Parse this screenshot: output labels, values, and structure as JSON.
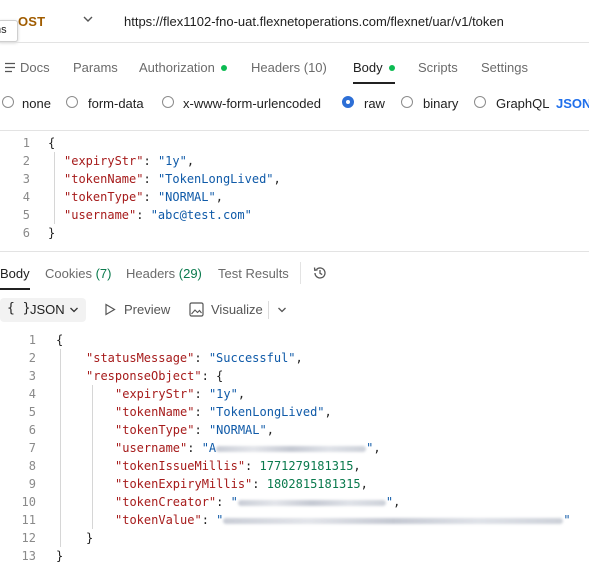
{
  "request": {
    "method": "OST",
    "url": "https://flex1102-fno-uat.flexnetoperations.com/flexnet/uar/v1/token",
    "tooltip": "ns"
  },
  "request_tabs": [
    {
      "label": "Docs"
    },
    {
      "label": "Params"
    },
    {
      "label": "Authorization"
    },
    {
      "label": "Headers (10)"
    },
    {
      "label": "Body"
    },
    {
      "label": "Scripts"
    },
    {
      "label": "Settings"
    }
  ],
  "body_types": [
    "none",
    "form-data",
    "x-www-form-urlencoded",
    "raw",
    "binary",
    "GraphQL"
  ],
  "body_format": "JSON",
  "request_body": {
    "line_numbers": [
      "1",
      "2",
      "3",
      "4",
      "5",
      "6"
    ],
    "open": "{",
    "close": "}",
    "lines": [
      {
        "key": "\"expiryStr\"",
        "value": "\"1y\""
      },
      {
        "key": "\"tokenName\"",
        "value": "\"TokenLongLived\""
      },
      {
        "key": "\"tokenType\"",
        "value": "\"NORMAL\""
      },
      {
        "key": "\"username\"",
        "value": "\"abc@test.com\""
      }
    ]
  },
  "response_tabs": [
    {
      "label": "Body"
    },
    {
      "label": "Cookies",
      "count": "(7)"
    },
    {
      "label": "Headers",
      "count": "(29)"
    },
    {
      "label": "Test Results"
    }
  ],
  "response_toolbar": {
    "format": "JSON",
    "preview": "Preview",
    "visualize": "Visualize"
  },
  "response_body": {
    "line_numbers": [
      "1",
      "2",
      "3",
      "4",
      "5",
      "6",
      "7",
      "8",
      "9",
      "10",
      "11",
      "12",
      "13"
    ],
    "brace_open": "{",
    "brace_close": "}",
    "status_key": "\"statusMessage\"",
    "status_value": "\"Successful\"",
    "response_object_key": "\"responseObject\"",
    "inner_open": "{",
    "inner_close": "}",
    "expiry_key": "\"expiryStr\"",
    "expiry_value": "\"1y\"",
    "token_name_key": "\"tokenName\"",
    "token_name_value": "\"TokenLongLived\"",
    "token_type_key": "\"tokenType\"",
    "token_type_value": "\"NORMAL\"",
    "username_key": "\"username\"",
    "username_value_prefix": "\"A",
    "issue_key": "\"tokenIssueMillis\"",
    "issue_value": "1771279181315",
    "expiry_millis_key": "\"tokenExpiryMillis\"",
    "expiry_millis_value": "1802815181315",
    "creator_key": "\"tokenCreator\"",
    "creator_value_prefix": "\"",
    "token_value_key": "\"tokenValue\"",
    "token_value_prefix": "\""
  }
}
